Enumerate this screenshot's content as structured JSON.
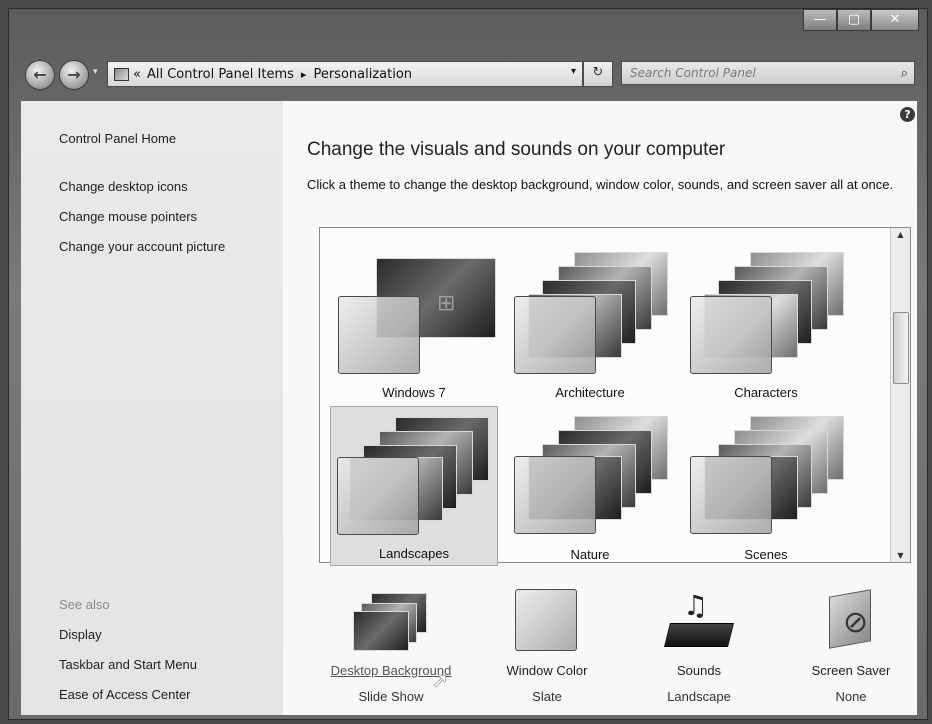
{
  "titlebar": {
    "minimize": "—",
    "maximize": "▢",
    "close": "✕"
  },
  "nav": {
    "back_glyph": "←",
    "forward_glyph": "→",
    "history_glyph": "▾",
    "address": {
      "overflow": "«",
      "crumbs": [
        "All Control Panel Items",
        "Personalization"
      ],
      "separator": "▸",
      "dropdown_glyph": "▾"
    },
    "refresh_glyph": "↻",
    "search": {
      "placeholder": "Search Control Panel",
      "icon": "search-icon"
    }
  },
  "sidebar": {
    "home": "Control Panel Home",
    "links": [
      "Change desktop icons",
      "Change mouse pointers",
      "Change your account picture"
    ],
    "see_also_heading": "See also",
    "see_also": [
      "Display",
      "Taskbar and Start Menu",
      "Ease of Access Center"
    ]
  },
  "main": {
    "help_glyph": "?",
    "heading": "Change the visuals and sounds on your computer",
    "description": "Click a theme to change the desktop background, window color, sounds, and screen saver all at once.",
    "themes": [
      {
        "name": "Windows 7",
        "selected": false
      },
      {
        "name": "Architecture",
        "selected": false
      },
      {
        "name": "Characters",
        "selected": false
      },
      {
        "name": "Landscapes",
        "selected": true
      },
      {
        "name": "Nature",
        "selected": false
      },
      {
        "name": "Scenes",
        "selected": false
      }
    ],
    "settings": [
      {
        "label": "Desktop Background",
        "value": "Slide Show",
        "icon": "desktop-background-icon"
      },
      {
        "label": "Window Color",
        "value": "Slate",
        "icon": "window-color-icon"
      },
      {
        "label": "Sounds",
        "value": "Landscape",
        "icon": "sounds-icon"
      },
      {
        "label": "Screen Saver",
        "value": "None",
        "icon": "screen-saver-icon"
      }
    ]
  },
  "colors": {
    "window_chrome": "#6a6a6a",
    "pane_left": "#e7e7e7",
    "pane_main": "#f8f8f8",
    "selected_tile": "#dedede"
  }
}
